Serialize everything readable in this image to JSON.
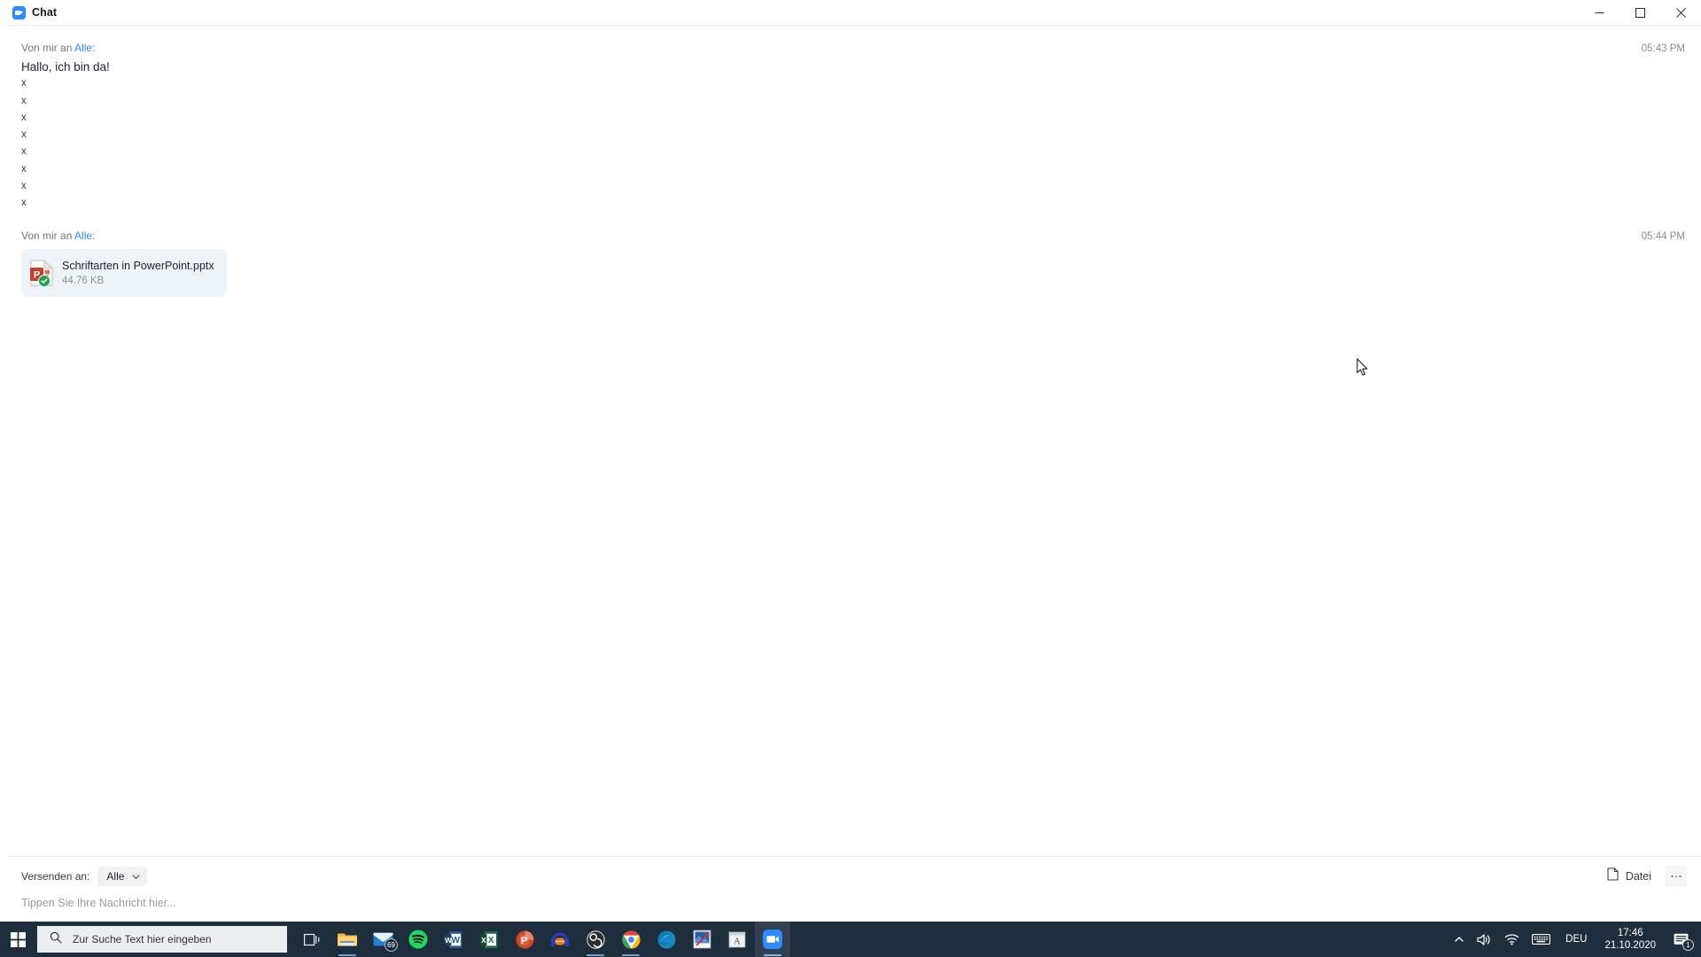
{
  "window": {
    "title": "Chat",
    "app_icon": "zoom-video-icon",
    "controls": {
      "minimize": "minimize-icon",
      "maximize": "maximize-icon",
      "close": "close-icon"
    }
  },
  "messages": [
    {
      "from_prefix": "Von mir an ",
      "to": "Alle",
      "colon": ":",
      "time": "05:43 PM",
      "text": "Hallo, ich bin da!",
      "extra_lines": [
        "x",
        "x",
        "x",
        "x",
        "x",
        "x",
        "x",
        "x"
      ]
    },
    {
      "from_prefix": "Von mir an ",
      "to": "Alle",
      "colon": ":",
      "time": "05:44 PM",
      "attachment": {
        "icon": "powerpoint-file-icon",
        "name": "Schriftarten in PowerPoint.pptx",
        "size": "44.76 KB",
        "status_icon": "download-complete-check-icon"
      }
    }
  ],
  "compose": {
    "send_to_label": "Versenden an:",
    "send_to_value": "Alle",
    "send_to_chevron": "chevron-down-icon",
    "file_button_label": "Datei",
    "file_button_icon": "file-icon",
    "more_button_icon": "more-options-icon",
    "input_placeholder": "Tippen Sie Ihre Nachricht hier..."
  },
  "taskbar": {
    "start_icon": "windows-start-icon",
    "search_icon": "search-icon",
    "search_placeholder": "Zur Suche Text hier eingeben",
    "apps": [
      {
        "name": "task-view",
        "icon": "task-view-icon",
        "running": false,
        "active": false
      },
      {
        "name": "file-explorer",
        "icon": "file-explorer-icon",
        "running": true,
        "active": false
      },
      {
        "name": "mail",
        "icon": "mail-icon",
        "running": false,
        "active": false,
        "badge": "69"
      },
      {
        "name": "spotify",
        "icon": "spotify-icon",
        "running": false,
        "active": false
      },
      {
        "name": "word",
        "icon": "word-icon",
        "running": false,
        "active": false
      },
      {
        "name": "excel",
        "icon": "excel-icon",
        "running": false,
        "active": false
      },
      {
        "name": "powerpoint",
        "icon": "powerpoint-icon",
        "running": false,
        "active": false
      },
      {
        "name": "audacity",
        "icon": "audacity-icon",
        "running": false,
        "active": false
      },
      {
        "name": "obs-studio",
        "icon": "obs-icon",
        "running": true,
        "active": false
      },
      {
        "name": "google-chrome",
        "icon": "chrome-icon",
        "running": true,
        "active": false
      },
      {
        "name": "microsoft-edge",
        "icon": "edge-icon",
        "running": false,
        "active": false
      },
      {
        "name": "photo-editor",
        "icon": "photo-editor-icon",
        "running": false,
        "active": false
      },
      {
        "name": "font-viewer",
        "icon": "font-viewer-icon",
        "running": false,
        "active": false
      },
      {
        "name": "zoom",
        "icon": "zoom-icon",
        "running": true,
        "active": true
      }
    ],
    "tray": {
      "chevron_icon": "show-hidden-icons-chevron",
      "volume_icon": "volume-icon",
      "network_icon": "wifi-icon",
      "keyboard_icon": "touch-keyboard-icon",
      "language": "DEU",
      "time": "17:46",
      "date": "21.10.2020",
      "notifications_icon": "action-center-icon",
      "notifications_count": "1"
    }
  },
  "colors": {
    "accent": "#2d8cff",
    "taskbar": "#1f2e3c",
    "card_bg": "#eef3f8",
    "check_green": "#22a24c"
  }
}
